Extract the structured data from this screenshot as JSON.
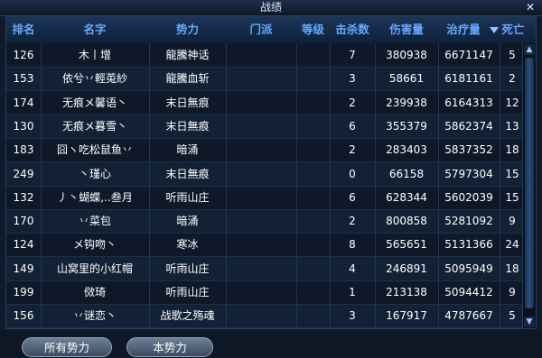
{
  "window": {
    "title": "战绩",
    "close_glyph": "✕"
  },
  "columns": {
    "rank": "排名",
    "name": "名字",
    "faction": "势力",
    "sect": "门派",
    "level": "等级",
    "kills": "击杀数",
    "damage": "伤害量",
    "healing": "治疗量",
    "deaths": "死亡"
  },
  "sort": {
    "column": "healing",
    "direction": "descending",
    "icon": "sort-down-icon"
  },
  "rows": [
    {
      "rank": "126",
      "name": "木丨增",
      "faction": "龍騰神话",
      "sect": "",
      "level": "",
      "kills": "7",
      "damage": "380938",
      "healing": "6671147",
      "deaths": "5"
    },
    {
      "rank": "153",
      "name": "依兮丷輕莵紗",
      "faction": "龍騰血斩",
      "sect": "",
      "level": "",
      "kills": "3",
      "damage": "58661",
      "healing": "6181161",
      "deaths": "2"
    },
    {
      "rank": "174",
      "name": "无痕メ馨语丶",
      "faction": "末日無痕",
      "sect": "",
      "level": "",
      "kills": "2",
      "damage": "239938",
      "healing": "6164313",
      "deaths": "12"
    },
    {
      "rank": "130",
      "name": "无痕メ暮雪丶",
      "faction": "末日無痕",
      "sect": "",
      "level": "",
      "kills": "6",
      "damage": "355379",
      "healing": "5862374",
      "deaths": "13"
    },
    {
      "rank": "183",
      "name": "囧ヽ吃松鼠鱼丷",
      "faction": "暗涌",
      "sect": "",
      "level": "",
      "kills": "2",
      "damage": "283403",
      "healing": "5837352",
      "deaths": "18"
    },
    {
      "rank": "249",
      "name": "丶瑾心",
      "faction": "末日無痕",
      "sect": "",
      "level": "",
      "kills": "0",
      "damage": "66158",
      "healing": "5797304",
      "deaths": "15"
    },
    {
      "rank": "132",
      "name": "丿丶蝴蝶,..叁月",
      "faction": "听雨山庄",
      "sect": "",
      "level": "",
      "kills": "6",
      "damage": "628344",
      "healing": "5602039",
      "deaths": "15"
    },
    {
      "rank": "170",
      "name": "丷菜包",
      "faction": "暗涌",
      "sect": "",
      "level": "",
      "kills": "2",
      "damage": "800858",
      "healing": "5281092",
      "deaths": "9"
    },
    {
      "rank": "124",
      "name": "メ钩吻丶",
      "faction": "寒冰",
      "sect": "",
      "level": "",
      "kills": "8",
      "damage": "565651",
      "healing": "5131366",
      "deaths": "24"
    },
    {
      "rank": "149",
      "name": "山窝里的小红帽",
      "faction": "听雨山庄",
      "sect": "",
      "level": "",
      "kills": "4",
      "damage": "246891",
      "healing": "5095949",
      "deaths": "18"
    },
    {
      "rank": "199",
      "name": "傚琦",
      "faction": "听雨山庄",
      "sect": "",
      "level": "",
      "kills": "1",
      "damage": "213138",
      "healing": "5094412",
      "deaths": "9"
    },
    {
      "rank": "156",
      "name": "丷谜恋丶",
      "faction": "战歌之殇魂",
      "sect": "",
      "level": "",
      "kills": "3",
      "damage": "167917",
      "healing": "4787667",
      "deaths": "5"
    }
  ],
  "scrollbar": {
    "up_icon": "scroll-up-arrow-icon",
    "down_icon": "scroll-down-arrow-icon",
    "up_glyph": "▲",
    "down_glyph": "▼"
  },
  "footer": {
    "all_factions_label": "所有势力",
    "this_faction_label": "本势力"
  },
  "colors": {
    "header_text": "#64a8ff",
    "row_text": "#ffffff",
    "panel_bg": "#0b1422"
  }
}
